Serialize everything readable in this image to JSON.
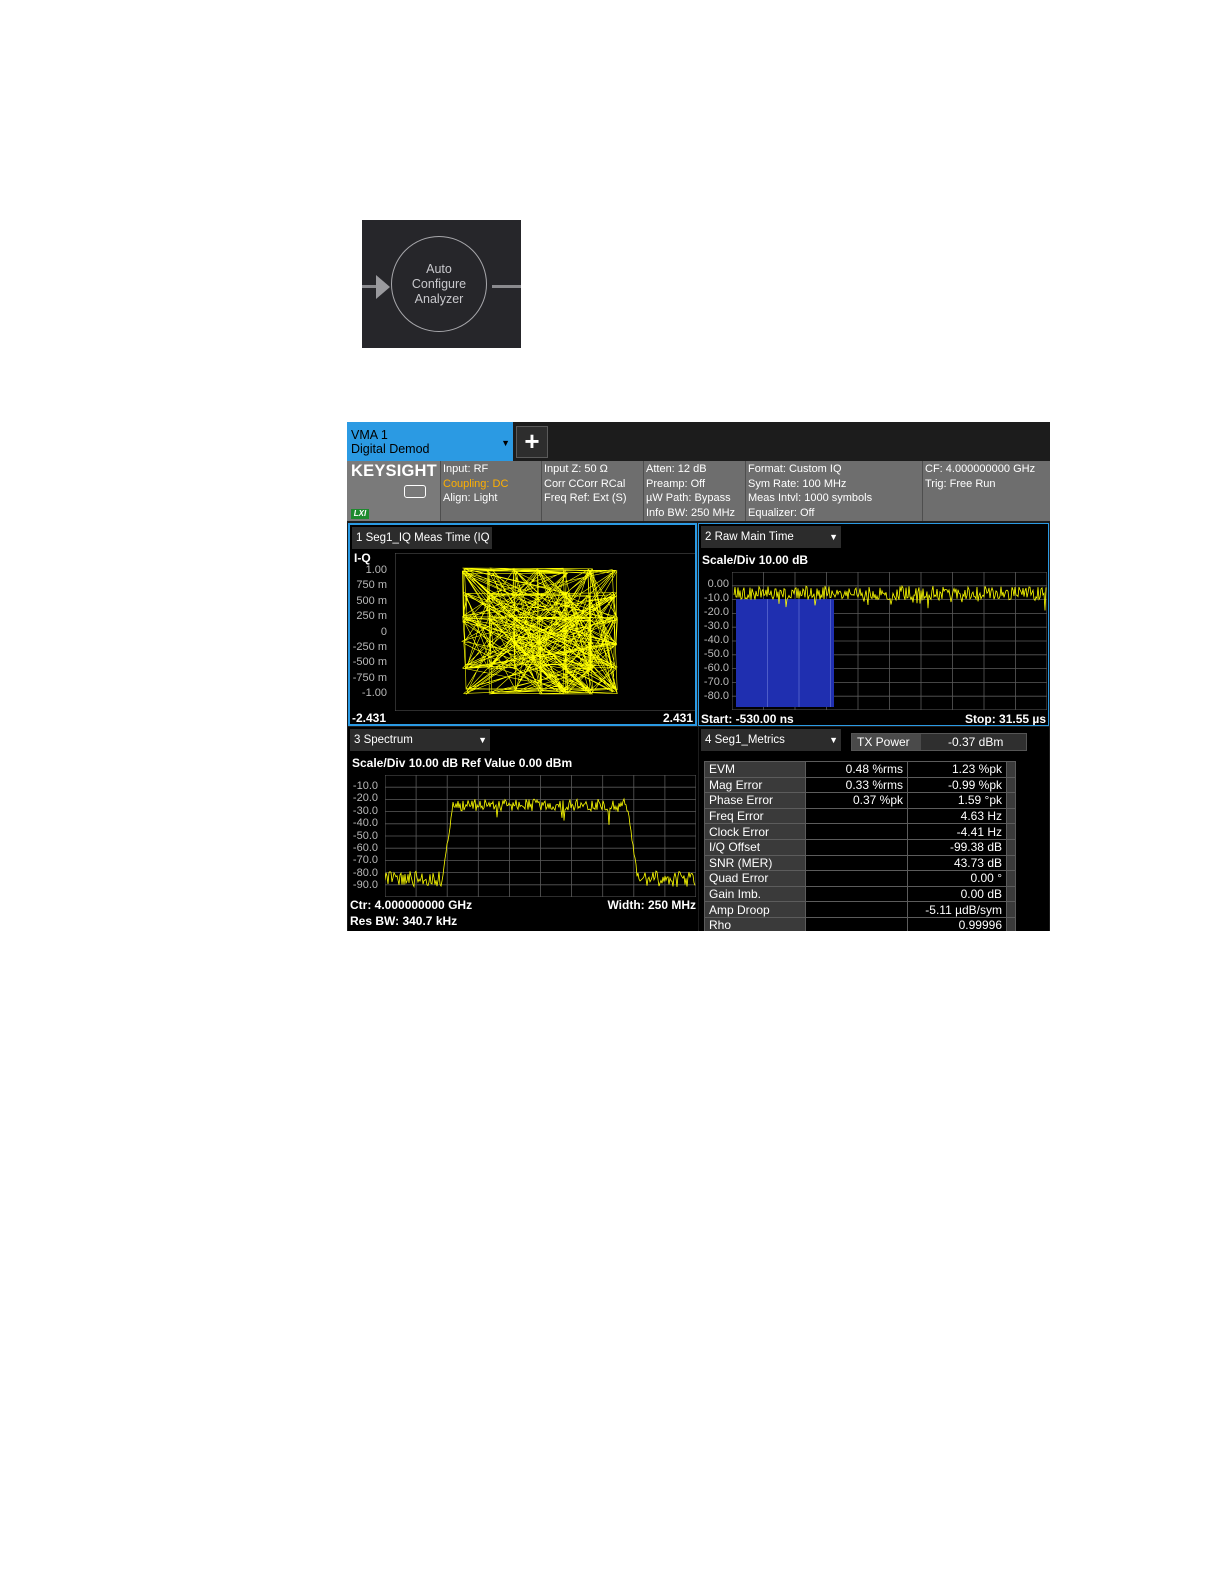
{
  "auto_configure": {
    "label_lines": [
      "Auto",
      "Configure",
      "Analyzer"
    ]
  },
  "tab": {
    "line1": "VMA 1",
    "line2": "Digital Demod",
    "add_label": "+"
  },
  "status": {
    "brand": "KEYSIGHT",
    "lxi": "LXI",
    "col1": [
      "Input: RF",
      "Coupling: DC",
      "Align: Light"
    ],
    "col2": [
      "Input Z: 50 Ω",
      "Corr CCorr RCal",
      "Freq Ref: Ext (S)"
    ],
    "col3": [
      "Atten: 12 dB",
      "Preamp: Off",
      "µW Path: Bypass",
      "Info BW: 250 MHz"
    ],
    "col4": [
      "Format: Custom IQ",
      "Sym Rate: 100 MHz",
      "Meas Intvl: 1000 symbols",
      "Equalizer: Off"
    ],
    "col5": [
      "CF: 4.000000000 GHz",
      "Trig: Free Run"
    ]
  },
  "pane1": {
    "title": "1 Seg1_IQ Meas Time (IQ",
    "trace_label": "I-Q",
    "y_ticks": [
      "1.00",
      "750 m",
      "500 m",
      "250 m",
      "0",
      "-250 m",
      "-500 m",
      "-750 m",
      "-1.00"
    ],
    "x_start": "-2.431",
    "x_stop": "2.431"
  },
  "pane2": {
    "title": "2 Raw Main Time",
    "scale": "Scale/Div 10.00 dB",
    "y_ticks": [
      "0.00",
      "-10.0",
      "-20.0",
      "-30.0",
      "-40.0",
      "-50.0",
      "-60.0",
      "-70.0",
      "-80.0"
    ],
    "start": "Start: -530.00 ns",
    "stop": "Stop: 31.55 µs"
  },
  "pane3": {
    "title": "3 Spectrum",
    "scale": "Scale/Div 10.00 dB Ref Value 0.00 dBm",
    "y_ticks": [
      "-10.0",
      "-20.0",
      "-30.0",
      "-40.0",
      "-50.0",
      "-60.0",
      "-70.0",
      "-80.0",
      "-90.0"
    ],
    "center": "Ctr: 4.000000000 GHz",
    "width": "Width: 250 MHz",
    "rbw": "Res BW: 340.7 kHz"
  },
  "pane4": {
    "title": "4 Seg1_Metrics",
    "tx_power_label": "TX Power",
    "tx_power_value": "-0.37 dBm",
    "rows": [
      {
        "label": "EVM",
        "v1": "0.48 %rms",
        "v2": "1.23 %pk"
      },
      {
        "label": "Mag Error",
        "v1": "0.33 %rms",
        "v2": "-0.99 %pk"
      },
      {
        "label": "Phase Error",
        "v1": "0.37 %pk",
        "v2": "1.59 °pk"
      },
      {
        "label": "Freq Error",
        "v1": "",
        "v2": "4.63 Hz"
      },
      {
        "label": "Clock Error",
        "v1": "",
        "v2": "-4.41 Hz"
      },
      {
        "label": "I/Q Offset",
        "v1": "",
        "v2": "-99.38 dB"
      },
      {
        "label": "SNR (MER)",
        "v1": "",
        "v2": "43.73 dB"
      },
      {
        "label": "Quad Error",
        "v1": "",
        "v2": "0.00 °"
      },
      {
        "label": "Gain Imb.",
        "v1": "",
        "v2": "0.00 dB"
      },
      {
        "label": "Amp Droop",
        "v1": "",
        "v2": "-5.11 µdB/sym"
      },
      {
        "label": "Rho",
        "v1": "",
        "v2": "0.99996"
      }
    ]
  },
  "colors": {
    "trace": "#ffff00",
    "highlight": "#2b9ae3",
    "capture_fill": "#1f2fb0",
    "grid": "#5a5a5a"
  }
}
